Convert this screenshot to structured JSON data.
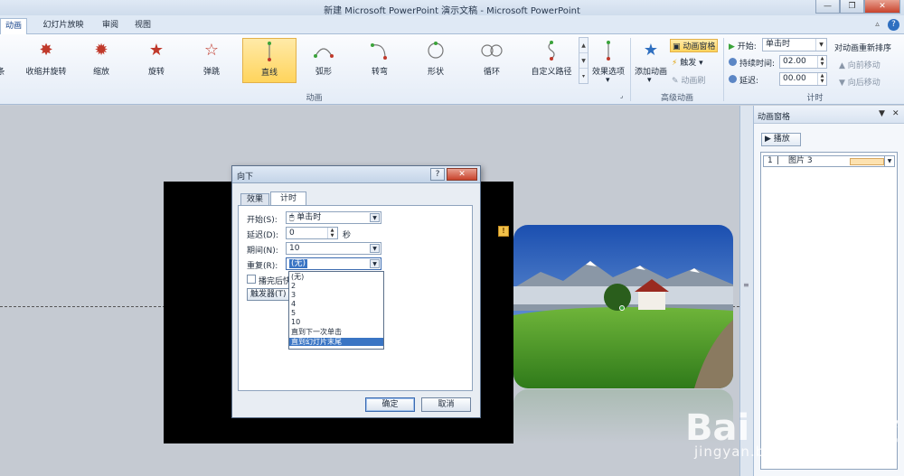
{
  "window": {
    "title": "新建 Microsoft PowerPoint 演示文稿  -  Microsoft PowerPoint",
    "minimize": "—",
    "restore": "❐",
    "close": "✕"
  },
  "tabs": [
    {
      "label": "动画",
      "active": true
    },
    {
      "label": "幻灯片放映",
      "active": false
    },
    {
      "label": "审阅",
      "active": false
    },
    {
      "label": "视图",
      "active": false
    }
  ],
  "tab_help": "?",
  "ribbon": {
    "gallery": [
      {
        "label": "条",
        "icon": "spiral-icon"
      },
      {
        "label": "收缩并旋转",
        "icon": "shrink-turn-icon"
      },
      {
        "label": "缩放",
        "icon": "zoom-burst-icon"
      },
      {
        "label": "旋转",
        "icon": "spin-star-icon"
      },
      {
        "label": "弹跳",
        "icon": "bounce-star-icon"
      },
      {
        "label": "直线",
        "icon": "line-path-icon",
        "selected": true
      },
      {
        "label": "弧形",
        "icon": "arc-path-icon"
      },
      {
        "label": "转弯",
        "icon": "turn-path-icon"
      },
      {
        "label": "形状",
        "icon": "shape-path-icon"
      },
      {
        "label": "循环",
        "icon": "loop-path-icon"
      },
      {
        "label": "自定义路径",
        "icon": "custom-path-icon"
      }
    ],
    "effect_options": "效果选项",
    "group_animation": "动画",
    "add_animation": "添加动画",
    "anim_pane_btn": "动画窗格",
    "trigger": "触发",
    "anim_painter": "动画刷",
    "group_advanced": "高级动画",
    "timing": {
      "start_label": "开始:",
      "start_value": "单击时",
      "duration_label": "持续时间:",
      "duration_value": "02.00",
      "delay_label": "延迟:",
      "delay_value": "00.00",
      "reorder": "对动画重新排序",
      "move_earlier": "向前移动",
      "move_later": "向后移动",
      "group_timing": "计时"
    }
  },
  "pane": {
    "title": "动画窗格",
    "play": "▶ 播放",
    "items": [
      {
        "index": "1",
        "name": "图片 3"
      }
    ]
  },
  "dialog": {
    "title": "向下",
    "help": "?",
    "close": "✕",
    "tab_effect": "效果",
    "tab_timing": "计时",
    "start_label": "开始(S):",
    "start_value": "单击时",
    "delay_label": "延迟(D):",
    "delay_value": "0",
    "delay_unit": "秒",
    "duration_label": "期间(N):",
    "duration_value": "10",
    "repeat_label": "重复(R):",
    "repeat_value": "(无)",
    "rewind_label": "播完后快",
    "trigger_btn": "触发器(T)",
    "repeat_options": [
      {
        "label": "(无)",
        "selected": false
      },
      {
        "label": "2",
        "selected": false
      },
      {
        "label": "3",
        "selected": false
      },
      {
        "label": "4",
        "selected": false
      },
      {
        "label": "5",
        "selected": false
      },
      {
        "label": "10",
        "selected": false
      },
      {
        "label": "直到下一次单击",
        "selected": false
      },
      {
        "label": "直到幻灯片末尾",
        "selected": true
      }
    ],
    "ok": "确定",
    "cancel": "取消"
  },
  "slide": {
    "marker": "!"
  },
  "watermark": {
    "brand": "Bai du 经验",
    "url": "jingyan.baidu.com"
  }
}
